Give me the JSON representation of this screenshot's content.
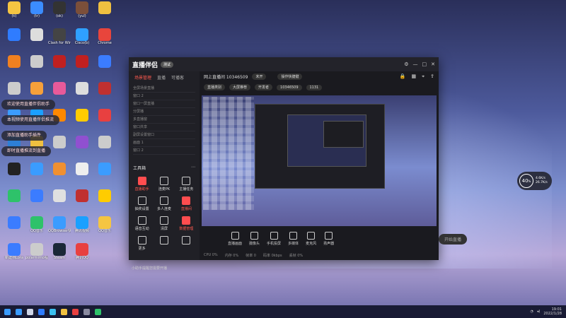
{
  "desktop": {
    "icons": [
      {
        "label": "(ti)",
        "color": "#f5c542"
      },
      {
        "label": "(tr)",
        "color": "#3b8cff"
      },
      {
        "label": "(ok)",
        "color": "#333"
      },
      {
        "label": "(yul)",
        "color": "#7b4f3a"
      },
      {
        "label": "",
        "color": "#f0c040"
      },
      {
        "label": "",
        "color": "#2f7cff"
      },
      {
        "label": "",
        "color": "#ddd"
      },
      {
        "label": "Clash for Windows",
        "color": "#444"
      },
      {
        "label": "Cisco(b)",
        "color": "#2fa0ff"
      },
      {
        "label": "Chrome",
        "color": "#e8453c"
      },
      {
        "label": "",
        "color": "#f08020"
      },
      {
        "label": "",
        "color": "#ccc"
      },
      {
        "label": "",
        "color": "#c02020"
      },
      {
        "label": "",
        "color": "#c02020"
      },
      {
        "label": "",
        "color": "#3b7cff"
      },
      {
        "label": "",
        "color": "#ccc"
      },
      {
        "label": "",
        "color": "#f6a03a"
      },
      {
        "label": "",
        "color": "#e85a9a"
      },
      {
        "label": "",
        "color": "#ddd"
      },
      {
        "label": "",
        "color": "#c03030"
      },
      {
        "label": "",
        "color": "#3b9cff"
      },
      {
        "label": "",
        "color": "#1aa0ff"
      },
      {
        "label": "",
        "color": "#ff8800"
      },
      {
        "label": "",
        "color": "#ffcc00"
      },
      {
        "label": "",
        "color": "#e84040"
      },
      {
        "label": "",
        "color": "#2d7fd6"
      },
      {
        "label": "",
        "color": "#f0c040"
      },
      {
        "label": "",
        "color": "#ccc"
      },
      {
        "label": "",
        "color": "#9050d0"
      },
      {
        "label": "",
        "color": "#ccc"
      },
      {
        "label": "",
        "color": "#222"
      },
      {
        "label": "",
        "color": "#3a9cff"
      },
      {
        "label": "",
        "color": "#f09030"
      },
      {
        "label": "",
        "color": "#eee"
      },
      {
        "label": "",
        "color": "#3b9cff"
      },
      {
        "label": "",
        "color": "#2ec26a"
      },
      {
        "label": "",
        "color": "#3b7cff"
      },
      {
        "label": "",
        "color": "#e0e0e0"
      },
      {
        "label": "",
        "color": "#c03030"
      },
      {
        "label": "",
        "color": "#ffcc00"
      },
      {
        "label": "",
        "color": "#3b7cff"
      },
      {
        "label": "QQ音乐",
        "color": "#2ec26a"
      },
      {
        "label": "QQBrowser快捷方式",
        "color": "#3b9cff"
      },
      {
        "label": "腾讯视频",
        "color": "#1aa0ff"
      },
      {
        "label": "QQ音乐",
        "color": "#f5c542"
      },
      {
        "label": "新建档Lora",
        "color": "#3b7cff"
      },
      {
        "label": "polarmimo程序",
        "color": "#ccc"
      },
      {
        "label": "Steam",
        "color": "#1b2838"
      },
      {
        "label": "腾讯QQ",
        "color": "#e84040"
      }
    ]
  },
  "toasts": [
    "欢迎使用直播伴侣助手",
    "本视频使用直播伴侣推流",
    "添加直播助手插件",
    "即时直播推流到直播"
  ],
  "app": {
    "logo": "直播伴侣",
    "tag": "测试",
    "window_controls": [
      "设置",
      "最小化",
      "最大化",
      "关闭"
    ],
    "left_tabs": [
      "场景管理",
      "直播",
      "可播客"
    ],
    "left_items": [
      "全屏场景直播",
      "窗口 2",
      "窗口一屏直播",
      "分屏播",
      "多直播窗",
      "窗口共享",
      "副屏设置窗口",
      "画面 1",
      "窗口 2"
    ],
    "tools_title": "工具箱",
    "tools": [
      {
        "label": "直播助手",
        "red": true
      },
      {
        "label": "连麦PK",
        "red": false
      },
      {
        "label": "主播任务",
        "red": false
      },
      {
        "label": "抽奖设置",
        "red": false
      },
      {
        "label": "多人连麦",
        "red": false
      },
      {
        "label": "直播间",
        "red": true
      },
      {
        "label": "语音互动",
        "red": false
      },
      {
        "label": "清屏",
        "red": false
      },
      {
        "label": "数据管理",
        "red": true
      },
      {
        "label": "更多",
        "red": false
      },
      {
        "label": "",
        "red": false
      },
      {
        "label": "",
        "red": false
      }
    ],
    "room_title": "网上直播间 10346509",
    "room_status": "未开",
    "room_right_pill": "操作快捷键",
    "room_pills": [
      "直播类别",
      "大屏推荐",
      "开发者",
      "10346509",
      "1131"
    ],
    "bottom_buttons": [
      "直播画面",
      "摄像头",
      "手机投屏",
      "多媒体",
      "麦克风",
      "扬声器"
    ],
    "go_live": "开始直播",
    "status": [
      "CPU 0%",
      "内存 0%",
      "帧率 0",
      "码率 0kbps",
      "丢帧 0%"
    ],
    "notice": "小助手提醒您需要开播"
  },
  "widget": {
    "value": "40",
    "unit": "%",
    "up": "4.6K/s",
    "down": "26.7K/s"
  },
  "taskbar": {
    "icons": [
      "#3b9cff",
      "#cfd6e8",
      "#2f7cff",
      "#3bc0f0",
      "#f0c040",
      "#e84040",
      "#8a8aa0",
      "#2ec26a"
    ],
    "time": "19:01",
    "date": "2022/1/28"
  }
}
